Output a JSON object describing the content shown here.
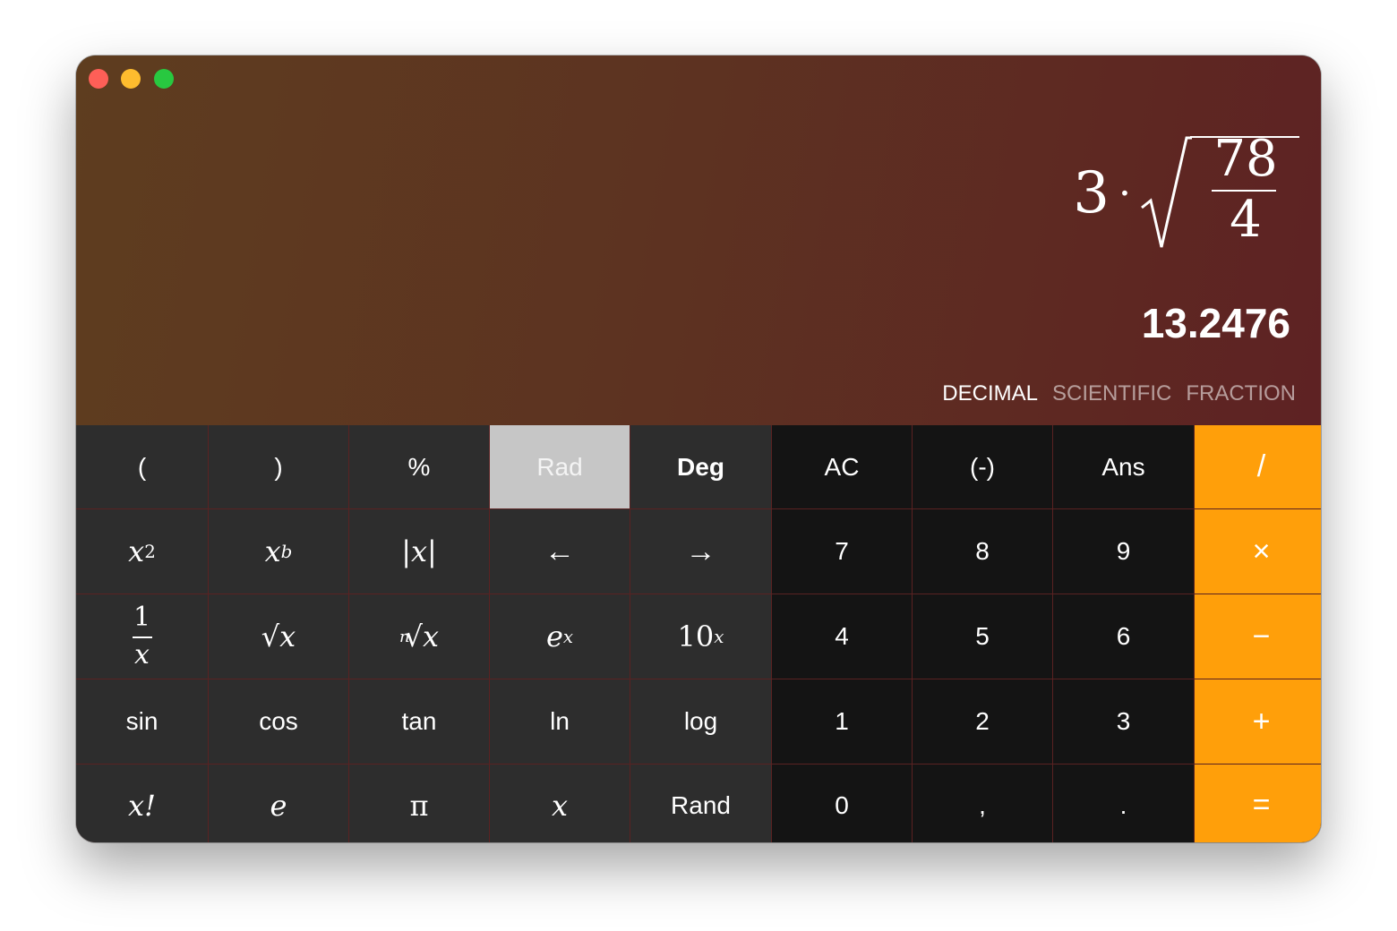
{
  "window": {
    "controls": [
      "close",
      "minimize",
      "zoom"
    ]
  },
  "display": {
    "expression": {
      "coefficient": "3",
      "operator": "·",
      "numerator": "78",
      "denominator": "4"
    },
    "result": "13.2476",
    "modes": [
      {
        "label": "DECIMAL",
        "active": true
      },
      {
        "label": "SCIENTIFIC",
        "active": false
      },
      {
        "label": "FRACTION",
        "active": false
      }
    ]
  },
  "keys": {
    "lparen": "(",
    "rparen": ")",
    "percent": "%",
    "rad": "Rad",
    "deg": "Deg",
    "ac": "AC",
    "negate": "(-)",
    "ans": "Ans",
    "divide": "/",
    "x_sq_base": "x",
    "x_sq_exp": "2",
    "x_pow_base": "x",
    "x_pow_exp": "b",
    "abs": "|x|",
    "left": "←",
    "right": "→",
    "seven": "7",
    "eight": "8",
    "nine": "9",
    "multiply": "×",
    "recip_num": "1",
    "recip_den": "x",
    "sqrt": "√x",
    "nroot_index": "n",
    "nroot": "√x",
    "exp_base": "e",
    "exp_exp": "x",
    "ten_base": "10",
    "ten_exp": "x",
    "four": "4",
    "five": "5",
    "six": "6",
    "minus": "−",
    "sin": "sin",
    "cos": "cos",
    "tan": "tan",
    "ln": "ln",
    "log": "log",
    "one": "1",
    "two": "2",
    "three": "3",
    "plus": "+",
    "factorial": "x!",
    "euler": "e",
    "pi": "π",
    "var_x": "x",
    "rand": "Rand",
    "zero": "0",
    "comma": ",",
    "point": ".",
    "equals": "="
  },
  "colors": {
    "operator_orange": "#ff9f0a",
    "function_key": "#2d2d2d",
    "number_key": "#141414",
    "rad_active": "#c6c6c6"
  }
}
